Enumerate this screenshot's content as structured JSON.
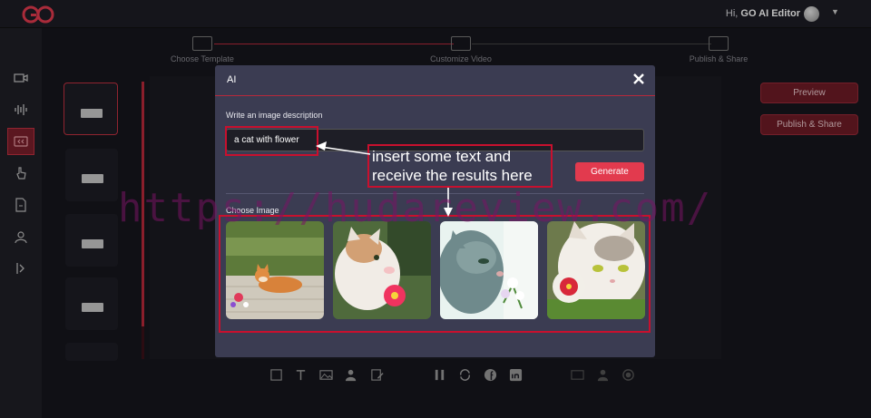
{
  "header": {
    "greeting_prefix": "Hi,",
    "user_name": "GO AI Editor"
  },
  "stepper": {
    "steps": [
      {
        "label": "Choose Template"
      },
      {
        "label": "Customize Video"
      },
      {
        "label": "Publish & Share"
      }
    ]
  },
  "actions": {
    "preview_label": "Preview",
    "publish_label": "Publish & Share"
  },
  "modal": {
    "title": "AI",
    "description_label": "Write an image description",
    "description_value": "a cat with flower",
    "generate_label": "Generate",
    "choose_label": "Choose Image",
    "images": [
      {
        "subject": "orange kitten lying on porch with flowers"
      },
      {
        "subject": "white cat sniffing pink flower"
      },
      {
        "subject": "grey cat sniffing white flowers"
      },
      {
        "subject": "white cat with red flower"
      }
    ]
  },
  "annotation": {
    "line1": "insert some text and",
    "line2": "receive the results here"
  },
  "watermark": "https://hudareview.com/",
  "colors": {
    "accent": "#e23a4e",
    "annotation_red": "#c8102e",
    "modal_bg": "#3b3c52",
    "app_bg": "#16161c"
  }
}
